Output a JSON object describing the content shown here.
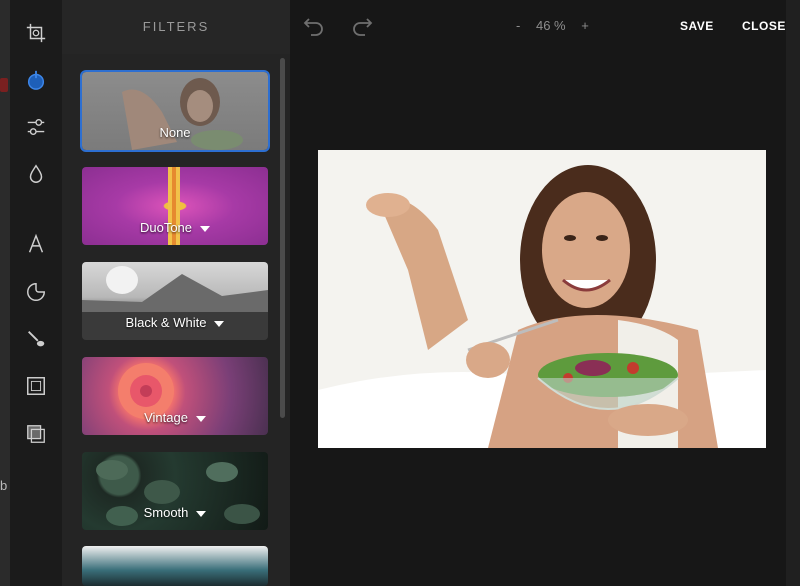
{
  "host": {
    "fragment_text": "b"
  },
  "rail": {
    "items": [
      {
        "icon": "crop-icon"
      },
      {
        "icon": "filter-icon",
        "active": true
      },
      {
        "icon": "adjust-sliders-icon"
      },
      {
        "icon": "drop-icon"
      },
      {
        "icon": "text-icon"
      },
      {
        "icon": "sticker-icon"
      },
      {
        "icon": "brush-icon"
      },
      {
        "icon": "frame-icon"
      },
      {
        "icon": "overlay-icon"
      }
    ]
  },
  "panel": {
    "title": "FILTERS",
    "filters": [
      {
        "label": "None",
        "has_dropdown": false,
        "selected": true
      },
      {
        "label": "DuoTone",
        "has_dropdown": true
      },
      {
        "label": "Black & White",
        "has_dropdown": true
      },
      {
        "label": "Vintage",
        "has_dropdown": true
      },
      {
        "label": "Smooth",
        "has_dropdown": true
      }
    ]
  },
  "toolbar": {
    "zoom_minus": "-",
    "zoom_value": "46 %",
    "zoom_plus": "+",
    "save_label": "SAVE",
    "close_label": "CLOSE"
  },
  "colors": {
    "accent": "#2d6fd1",
    "panel_bg": "#242424",
    "editor_bg": "#171717"
  }
}
